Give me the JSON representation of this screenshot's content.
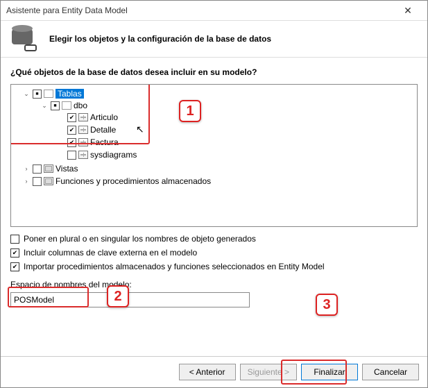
{
  "window": {
    "title": "Asistente para Entity Data Model"
  },
  "header": {
    "subtitle": "Elegir los objetos y la configuración de la base de datos"
  },
  "prompt": "¿Qué objetos de la base de datos desea incluir en su modelo?",
  "tree": {
    "tablas": {
      "label": "Tablas"
    },
    "dbo": {
      "label": "dbo"
    },
    "articulo": {
      "label": "Articulo"
    },
    "detalle": {
      "label": "Detalle"
    },
    "factura": {
      "label": "Factura"
    },
    "sysdiagrams": {
      "label": "sysdiagrams"
    },
    "vistas": {
      "label": "Vistas"
    },
    "sprocs": {
      "label": "Funciones y procedimientos almacenados"
    }
  },
  "options": {
    "plural": {
      "label": "Poner en plural o en singular los nombres de objeto generados",
      "checked": false
    },
    "fk": {
      "label": "Incluir columnas de clave externa en el modelo",
      "checked": true
    },
    "import_sp": {
      "label": "Importar procedimientos almacenados y funciones seleccionados en Entity Model",
      "checked": true
    }
  },
  "namespace": {
    "label": "Espacio de nombres del modelo:",
    "value": "POSModel"
  },
  "buttons": {
    "back": "< Anterior",
    "next": "Siguiente >",
    "finish": "Finalizar",
    "cancel": "Cancelar"
  },
  "callouts": {
    "one": "1",
    "two": "2",
    "three": "3"
  }
}
